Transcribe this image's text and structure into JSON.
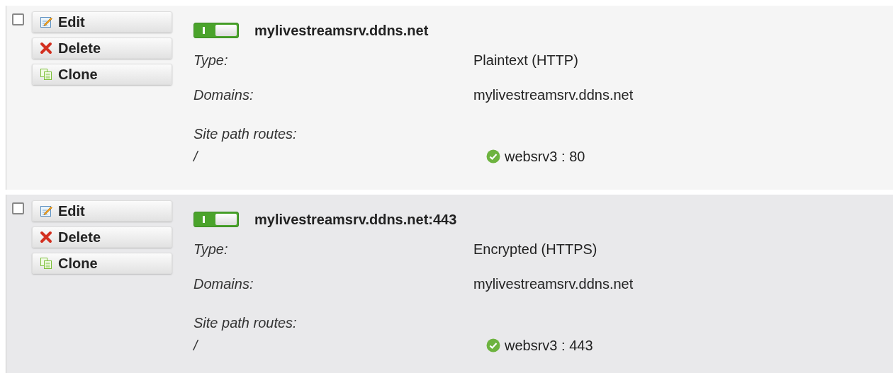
{
  "sites": [
    {
      "checked": false,
      "enabled": true,
      "name": "mylivestreamsrv.ddns.net",
      "actions": [
        {
          "kind": "edit",
          "label": "Edit"
        },
        {
          "kind": "delete",
          "label": "Delete"
        },
        {
          "kind": "clone",
          "label": "Clone"
        }
      ],
      "fields": [
        {
          "label": "Type:",
          "value": "Plaintext (HTTP)"
        },
        {
          "label": "Domains:",
          "value": "mylivestreamsrv.ddns.net"
        }
      ],
      "routes_label": "Site path routes:",
      "routes": [
        {
          "path": "/",
          "kind": "ok",
          "target": "websrv3 : 80"
        }
      ]
    },
    {
      "checked": false,
      "enabled": true,
      "name": "mylivestreamsrv.ddns.net:443",
      "actions": [
        {
          "kind": "edit",
          "label": "Edit"
        },
        {
          "kind": "delete",
          "label": "Delete"
        },
        {
          "kind": "clone",
          "label": "Clone"
        }
      ],
      "fields": [
        {
          "label": "Type:",
          "value": "Encrypted (HTTPS)"
        },
        {
          "label": "Domains:",
          "value": "mylivestreamsrv.ddns.net"
        }
      ],
      "routes_label": "Site path routes:",
      "routes": [
        {
          "path": "/",
          "kind": "ok",
          "target": "websrv3 : 443"
        }
      ]
    }
  ]
}
